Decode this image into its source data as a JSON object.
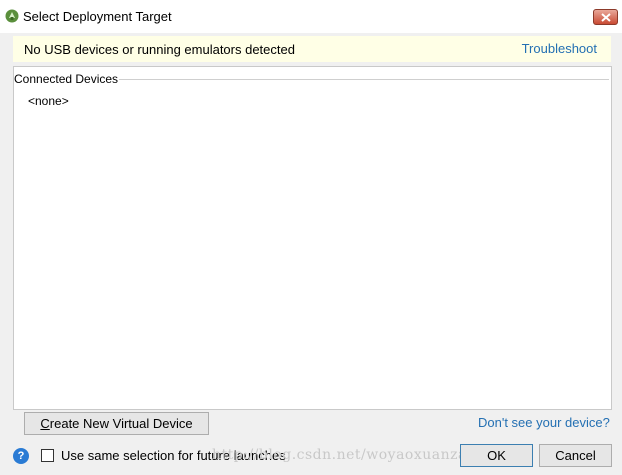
{
  "window": {
    "title": "Select Deployment Target"
  },
  "banner": {
    "message": "No USB devices or running emulators detected",
    "link": "Troubleshoot"
  },
  "devices": {
    "section_title": "Connected Devices",
    "empty_item": "<none>"
  },
  "actions": {
    "create_label_mnemonic": "C",
    "create_label_rest": "reate New Virtual Device",
    "help_link": "Don't see your device?",
    "checkbox_label": "Use same selection for future launches",
    "ok_label": "OK",
    "cancel_label": "Cancel"
  },
  "watermark": "http://blog.csdn.net/woyaoxuanzaixuanji",
  "colors": {
    "banner_bg": "#ffffe6",
    "link": "#2470b3",
    "dialog_bg": "#f0f0f0",
    "panel_bg": "#ffffff"
  }
}
